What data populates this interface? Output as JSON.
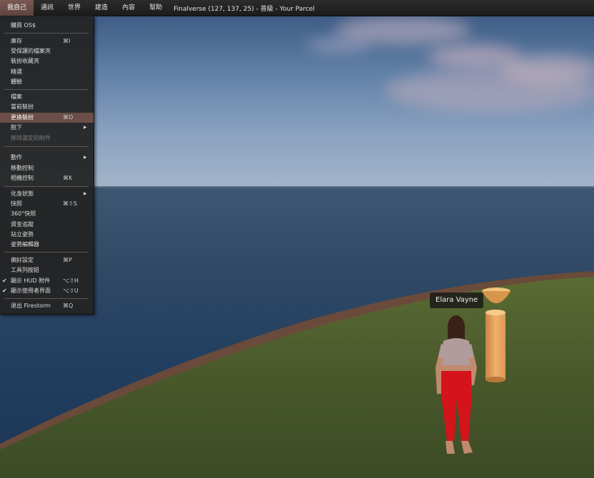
{
  "menubar": {
    "items": [
      "我自己",
      "通訊",
      "世界",
      "建造",
      "內容",
      "幫助"
    ],
    "location": "Finalverse (127, 137, 25) - 普級 - Your Parcel"
  },
  "menu": {
    "buy": "購買 OS$",
    "inventory": "庫存",
    "inventory_sc": "⌘I",
    "protected": "受保護的檔案夾",
    "outfits": "裝扮收藏夾",
    "picks": "精選",
    "experiences": "體驗",
    "profile": "檔案",
    "current_outfit": "當前裝扮",
    "change_outfit": "更換裝扮",
    "change_outfit_sc": "⌘O",
    "take_off": "脫下",
    "remove_attach": "移除選定的附件",
    "movement": "動作",
    "move_controls": "移動控制",
    "camera": "相機控制",
    "camera_sc": "⌘K",
    "avatar_health": "化身狀態",
    "snapshot": "快照",
    "snapshot_sc": "⌘⇧S",
    "snapshot360": "360°快照",
    "money": "資金追蹤",
    "stand": "站立姿勢",
    "pose_editor": "姿勢編輯器",
    "preferences": "偏好設定",
    "preferences_sc": "⌘P",
    "toolbar": "工具列按鈕",
    "show_hud": "顯示 HUD 附件",
    "show_hud_sc": "⌥⇧H",
    "show_ui": "顯示使用者界面",
    "show_ui_sc": "⌥⇧U",
    "quit": "退出 Firestorm",
    "quit_sc": "⌘Q",
    "check": "✔",
    "arrow": "▶"
  },
  "avatar": {
    "name": "Elara Vayne"
  },
  "colors": {
    "menu_highlight": "#6b4e47",
    "menu_bg": "#232323"
  }
}
